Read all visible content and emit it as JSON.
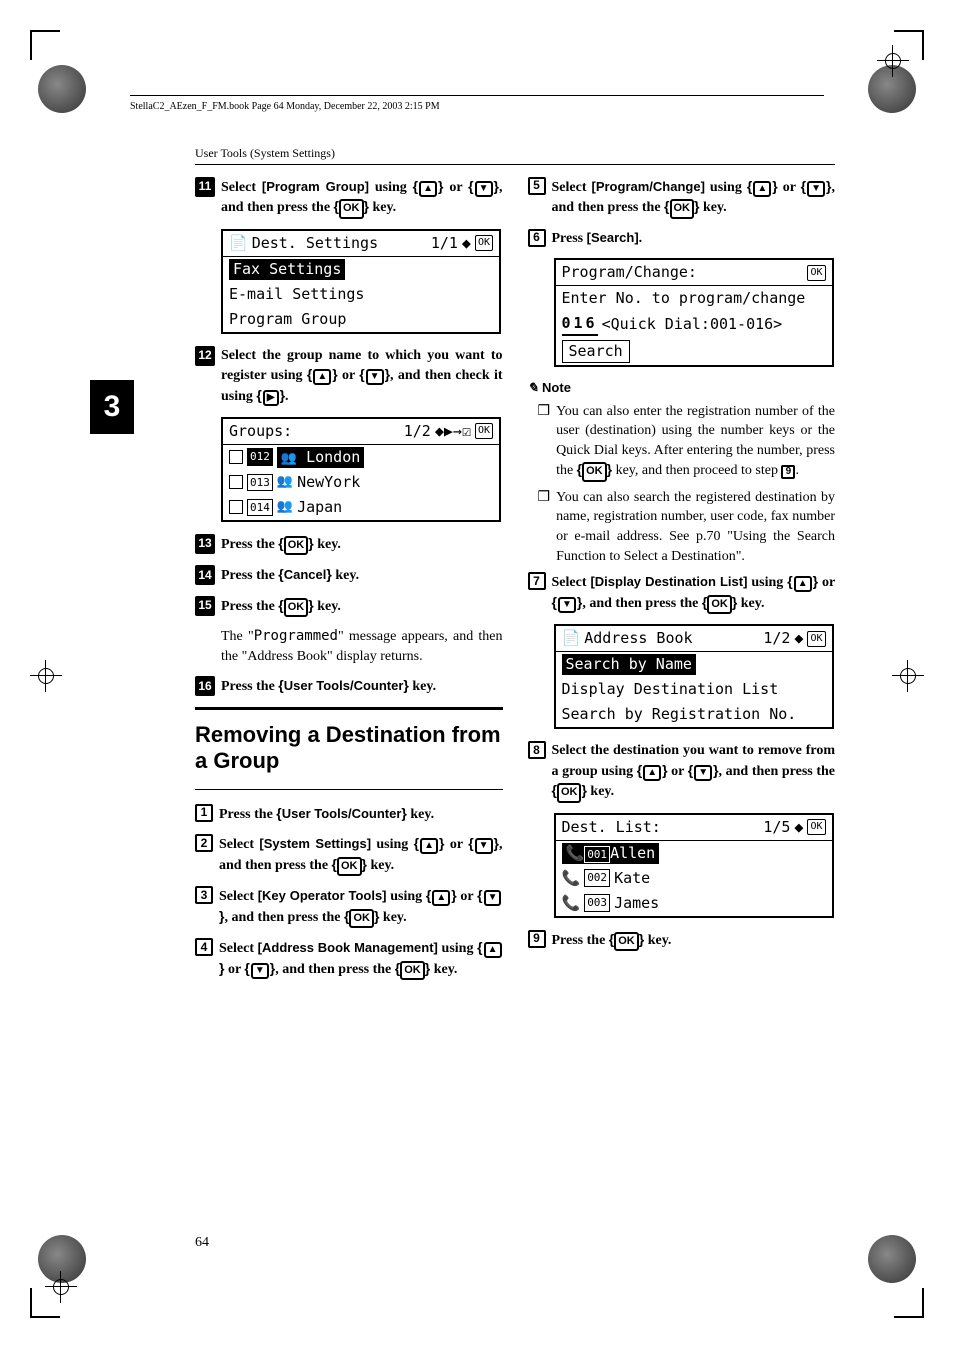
{
  "header_text": "StellaC2_AEzen_F_FM.book  Page 64  Monday, December 22, 2003  2:15 PM",
  "running_head": "User Tools (System Settings)",
  "tab_number": "3",
  "page_number": "64",
  "left": {
    "s11": "Select [Program Group] using {U} or {T}, and then press the {OK} key.",
    "lcd1": {
      "title_left": "Dest. Settings",
      "title_right": "1/1",
      "row1": "Fax Settings",
      "row2": "E-mail Settings",
      "row3": "Program Group"
    },
    "s12": "Select the group name to which you want to register using {U} or {T}, and then check it using {V}.",
    "lcd2": {
      "title_left": "Groups:",
      "title_right": "1/2",
      "row1_badge": "012",
      "row1_text": "London",
      "row2_badge": "013",
      "row2_text": "NewYork",
      "row3_badge": "014",
      "row3_text": "Japan"
    },
    "s13": "Press the {OK} key.",
    "s14": "Press the {Cancel} key.",
    "s15": "Press the {OK} key.",
    "s15_body": "The \"Programmed\" message appears, and then the \"Address Book\" display returns.",
    "s16": "Press the {User Tools/Counter} key.",
    "h2": "Removing a Destination from a Group",
    "a1": "Press the {User Tools/Counter} key.",
    "a2": "Select [System Settings] using {U} or {T}, and then press the {OK} key.",
    "a3": "Select [Key Operator Tools] using {U} or {T}, and then press the {OK} key.",
    "a4": "Select [Address Book Management] using {U} or {T}, and then press the {OK} key."
  },
  "right": {
    "a5": "Select [Program/Change] using {U} or {T}, and then press the {OK} key.",
    "a6": "Press [Search].",
    "lcd3": {
      "title_left": "Program/Change:",
      "row1": "Enter No. to program/change",
      "row2_num": "016",
      "row2_text": "<Quick Dial:001-016>",
      "row3": "Search"
    },
    "note_head": "Note",
    "note1": "You can also enter the registration number of the user (destination) using the number keys or the Quick Dial keys. After entering the number, press the {OK} key, and then proceed to step I.",
    "note2": "You can also search the registered destination by name, registration number, user code, fax number or e-mail address. See p.70 \"Using the Search Function to Select a Destination\".",
    "a7": "Select [Display Destination List] using {U} or {T}, and then press the {OK} key.",
    "lcd4": {
      "title_left": "Address Book",
      "title_right": "1/2",
      "row1": "Search by Name",
      "row2": "Display Destination List",
      "row3": "Search by Registration No."
    },
    "a8": "Select the destination you want to remove from a group using {U} or {T}, and then press the {OK} key.",
    "lcd5": {
      "title_left": "Dest. List:",
      "title_right": "1/5",
      "row1_badge": "001",
      "row1_text": "Allen",
      "row2_badge": "002",
      "row2_text": "Kate",
      "row3_badge": "003",
      "row3_text": "James"
    },
    "a9": "Press the {OK} key."
  }
}
